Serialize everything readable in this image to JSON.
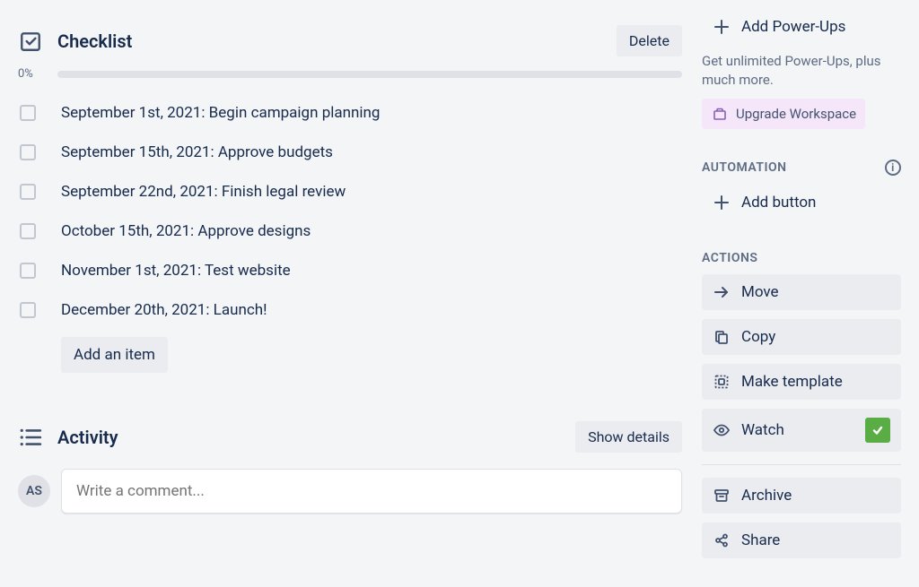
{
  "checklist": {
    "title": "Checklist",
    "delete_label": "Delete",
    "progress_pct": "0%",
    "items": [
      {
        "label": "September 1st, 2021: Begin campaign planning"
      },
      {
        "label": "September 15th, 2021: Approve budgets"
      },
      {
        "label": "September 22nd, 2021: Finish legal review"
      },
      {
        "label": "October 15th, 2021: Approve designs"
      },
      {
        "label": "November 1st, 2021: Test website"
      },
      {
        "label": "December 20th, 2021: Launch!"
      }
    ],
    "add_item_label": "Add an item"
  },
  "activity": {
    "title": "Activity",
    "show_details_label": "Show details",
    "avatar_initials": "AS",
    "comment_placeholder": "Write a comment..."
  },
  "sidebar": {
    "add_powerups_label": "Add Power-Ups",
    "powerups_note": "Get unlimited Power-Ups, plus much more.",
    "upgrade_label": "Upgrade Workspace",
    "automation_header": "AUTOMATION",
    "add_button_label": "Add button",
    "actions_header": "ACTIONS",
    "actions": {
      "move": "Move",
      "copy": "Copy",
      "template": "Make template",
      "watch": "Watch",
      "archive": "Archive",
      "share": "Share"
    }
  }
}
